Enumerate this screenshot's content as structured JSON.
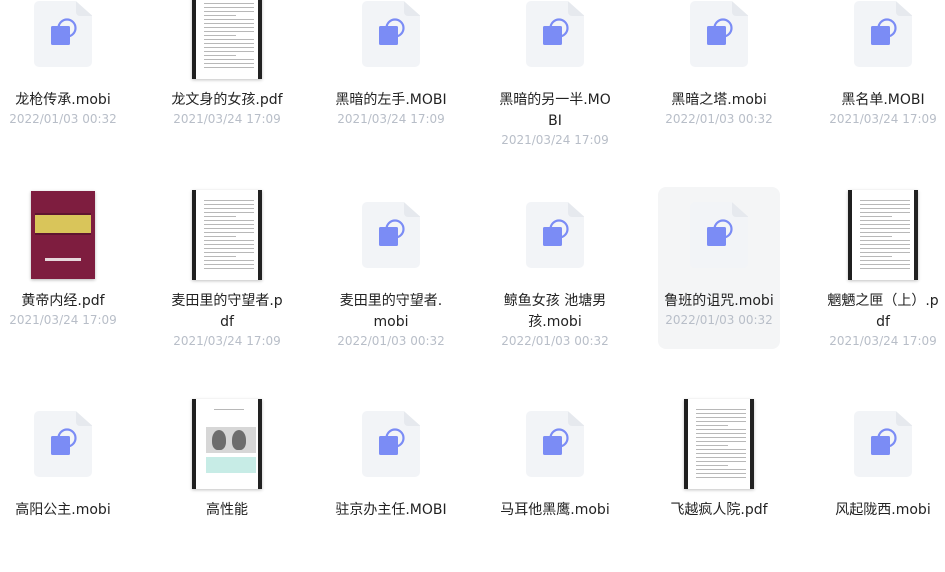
{
  "files": [
    {
      "name": "龙枪传承.mobi",
      "date": "2022/01/03 00:32",
      "thumb": "mobi"
    },
    {
      "name": "龙文身的女孩.pdf",
      "date": "2021/03/24 17:09",
      "thumb": "pdf"
    },
    {
      "name": "黑暗的左手.MOBI",
      "date": "2021/03/24 17:09",
      "thumb": "mobi"
    },
    {
      "name": "黑暗的另一半.MOBI",
      "date": "2021/03/24 17:09",
      "thumb": "mobi"
    },
    {
      "name": "黑暗之塔.mobi",
      "date": "2022/01/03 00:32",
      "thumb": "mobi"
    },
    {
      "name": "黑名单.MOBI",
      "date": "2021/03/24 17:09",
      "thumb": "mobi"
    },
    {
      "name": "黄帝内经.pdf",
      "date": "2021/03/24 17:09",
      "thumb": "cover"
    },
    {
      "name": "麦田里的守望者.pdf",
      "date": "2021/03/24 17:09",
      "thumb": "pdf"
    },
    {
      "name": "麦田里的守望者.mobi",
      "date": "2022/01/03 00:32",
      "thumb": "mobi"
    },
    {
      "name": "鲸鱼女孩 池塘男孩.mobi",
      "date": "2022/01/03 00:32",
      "thumb": "mobi"
    },
    {
      "name": "鲁班的诅咒.mobi",
      "date": "2022/01/03 00:32",
      "thumb": "mobi",
      "selected": true
    },
    {
      "name": "魍魉之匣（上）.pdf",
      "date": "2021/03/24 17:09",
      "thumb": "pdf"
    },
    {
      "name": "高阳公主.mobi",
      "date": "",
      "thumb": "mobi"
    },
    {
      "name": "高性能",
      "date": "",
      "thumb": "pdf-birds"
    },
    {
      "name": "驻京办主任.MOBI",
      "date": "",
      "thumb": "mobi"
    },
    {
      "name": "马耳他黑鹰.mobi",
      "date": "",
      "thumb": "mobi"
    },
    {
      "name": "飞越疯人院.pdf",
      "date": "",
      "thumb": "pdf"
    },
    {
      "name": "风起陇西.mobi",
      "date": "",
      "thumb": "mobi"
    }
  ],
  "colors": {
    "icon_accent": "#7b8cf5",
    "icon_bg": "#f2f4f7",
    "selected_bg": "#f4f5f6",
    "date": "#b8bec8"
  }
}
